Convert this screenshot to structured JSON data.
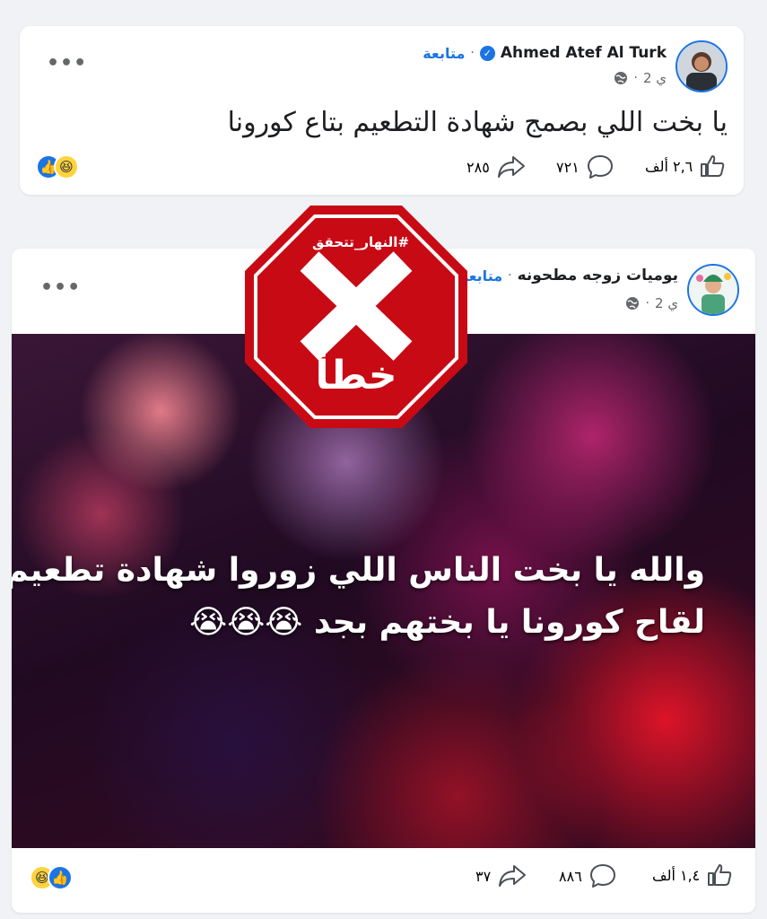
{
  "posts": [
    {
      "author": "Ahmed Atef Al Turk",
      "follow_label": "متابعة",
      "time": "2 ي",
      "text": "يا بخت اللي بصمج شهادة التطعيم بتاع كورونا",
      "likes": "٢,٦ ألف",
      "comments": "٧٢١",
      "shares": "٢٨٥"
    },
    {
      "author": "يوميات زوجه مطحونه",
      "follow_label": "متابعة",
      "time": "2 ي",
      "image_text_line1": "والله يا بخت الناس اللي زوروا شهادة تطعيم",
      "image_text_line2": "لقاح كورونا يا بختهم بجد 😭😭😭",
      "likes": "١,٤ ألف",
      "comments": "٨٨٦",
      "shares": "٣٧"
    }
  ],
  "stamp": {
    "tag": "#النهار_تتحقق",
    "verdict": "خطأ",
    "color": "#c80a14"
  },
  "icons": [
    "globe-icon",
    "like-icon",
    "comment-icon",
    "share-icon",
    "more-icon",
    "verified-icon",
    "haha-reaction-icon",
    "like-reaction-icon"
  ]
}
